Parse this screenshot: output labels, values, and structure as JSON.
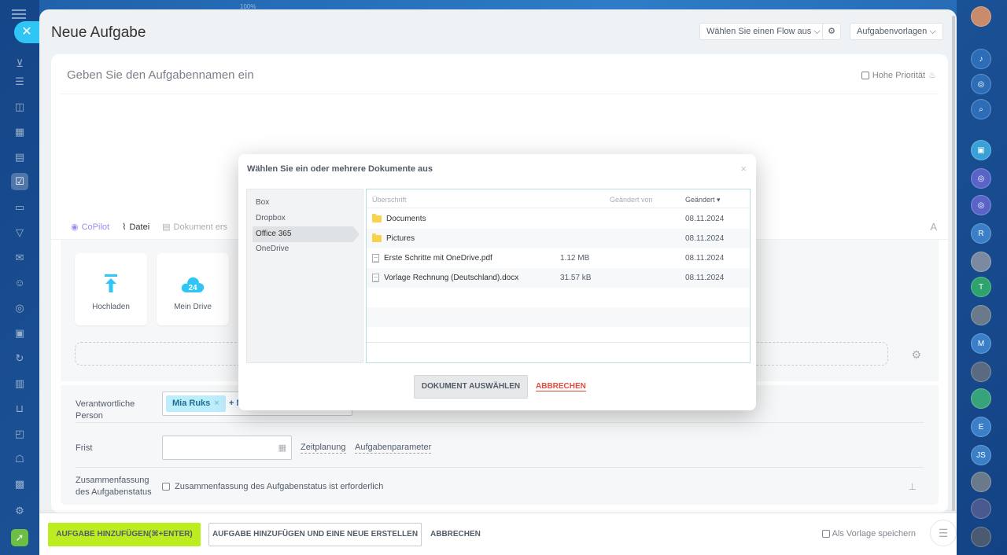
{
  "window": {
    "zoom": "100%"
  },
  "page": {
    "title": "Neue Aufgabe"
  },
  "header": {
    "flow_select": "Wählen Sie einen Flow aus",
    "templates": "Aufgabenvorlagen"
  },
  "task": {
    "name_placeholder": "Geben Sie den Aufgabennamen ein",
    "high_priority": "Hohe Priorität"
  },
  "toolbar": {
    "copilot": "CoPilot",
    "file": "Datei",
    "document": "Dokument ers",
    "font": "A"
  },
  "upload": {
    "cards": [
      {
        "label": "Hochladen",
        "icon": "upload-icon"
      },
      {
        "label": "Mein Drive",
        "icon": "cloud-24-icon",
        "badge": "24"
      }
    ]
  },
  "fields": {
    "responsible_label": "Verantwortliche Person",
    "responsible_tag": "Mia Ruks",
    "responsible_add": "+ M",
    "deadline_label": "Frist",
    "scheduling": "Zeitplanung",
    "task_params": "Aufgabenparameter",
    "status_summary_label": "Zusammenfassung des Aufgabenstatus",
    "status_summary_checkbox": "Zusammenfassung des Aufgabenstatus ist erforderlich"
  },
  "footer": {
    "add_task": "AUFGABE HINZUFÜGEN(⌘+ENTER)",
    "add_and_new": "AUFGABE HINZUFÜGEN UND EINE NEUE ERSTELLEN",
    "cancel": "ABBRECHEN",
    "save_template": "Als Vorlage speichern"
  },
  "dialog": {
    "title": "Wählen Sie ein oder mehrere Dokumente aus",
    "providers": [
      "Box",
      "Dropbox",
      "Office 365",
      "OneDrive"
    ],
    "active_provider": "Office 365",
    "columns": {
      "heading": "Überschrift",
      "changed_by": "Geändert von",
      "changed": "Geändert ▾"
    },
    "files": [
      {
        "name": "Documents",
        "type": "folder",
        "size": "",
        "date": "08.11.2024"
      },
      {
        "name": "Pictures",
        "type": "folder",
        "size": "",
        "date": "08.11.2024"
      },
      {
        "name": "Erste Schritte mit OneDrive.pdf",
        "type": "file",
        "size": "1.12 MB",
        "date": "08.11.2024"
      },
      {
        "name": "Vorlage Rechnung (Deutschland).docx",
        "type": "file",
        "size": "31.57 kB",
        "date": "08.11.2024"
      }
    ],
    "choose_button": "DOKUMENT AUSWÄHLEN",
    "cancel_button": "ABBRECHEN"
  },
  "rightnav": {
    "initials": [
      "R",
      "T",
      "M",
      "E",
      "JS"
    ]
  },
  "colors": {
    "accent": "#2fc6f6",
    "primary_button": "#bbed21",
    "danger": "#e14b3c"
  }
}
